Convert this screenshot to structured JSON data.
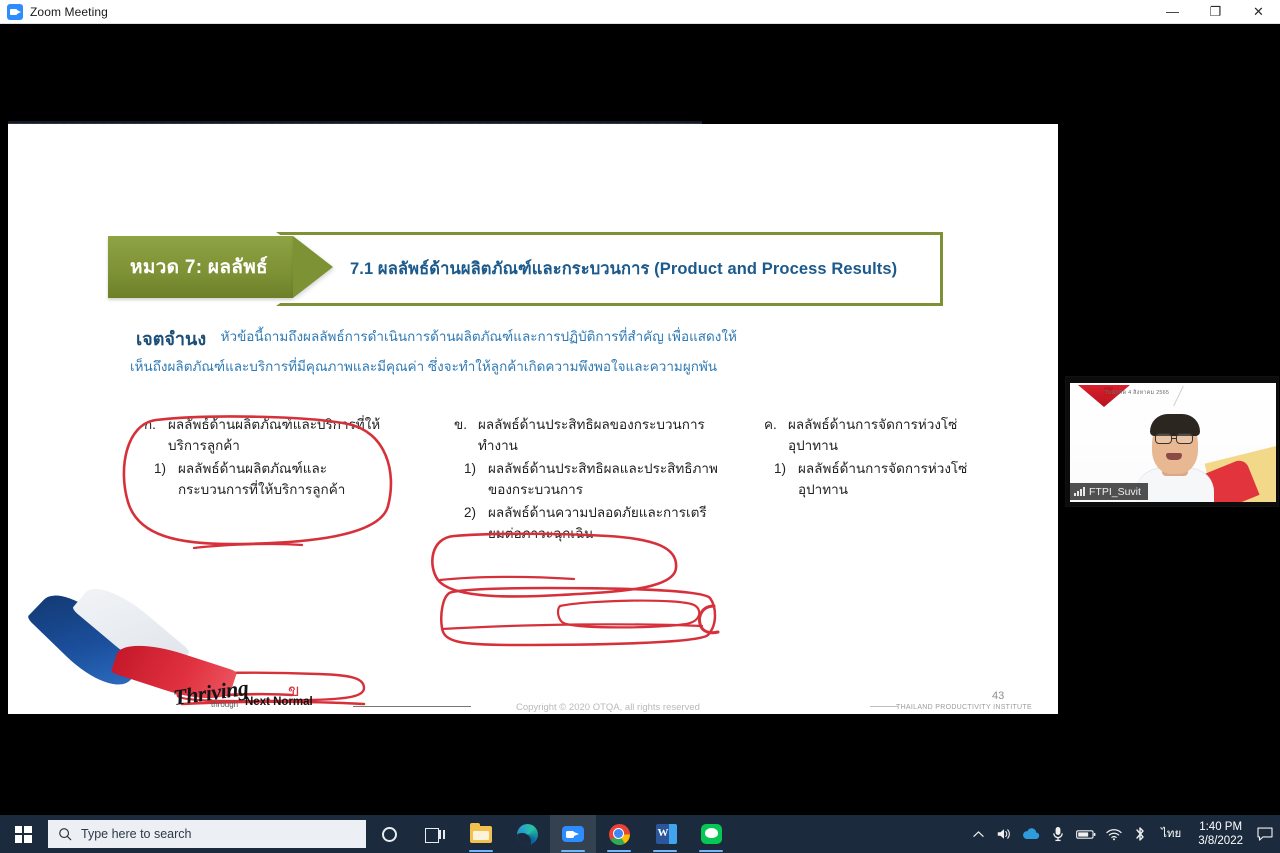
{
  "window": {
    "title": "Zoom Meeting",
    "app_icon": "zoom-video-icon",
    "minimize": "—",
    "maximize": "❐",
    "close": "✕"
  },
  "slide": {
    "banner": {
      "category_label": "หมวด 7: ผลลัพธ์",
      "title": "7.1  ผลลัพธ์ด้านผลิตภัณฑ์และกระบวนการ (Product and Process Results)",
      "green_hex": "#7d9135",
      "title_color_hex": "#1c5a8c"
    },
    "intent": {
      "label": "เจตจำนง",
      "line1": "หัวข้อนี้ถามถึงผลลัพธ์การดำเนินการด้านผลิตภัณฑ์และการปฏิบัติการที่สำคัญ เพื่อแสดงให้",
      "line2": "เห็นถึงผลิตภัณฑ์และบริการที่มีคุณภาพและมีคุณค่า ซึ่งจะทำให้ลูกค้าเกิดความพึงพอใจและความผูกพัน",
      "color_hex": "#2f7ab5"
    },
    "columns": [
      {
        "id": "column-a",
        "items": [
          {
            "marker": "ก.",
            "indent": false,
            "text": "ผลลัพธ์ด้านผลิตภัณฑ์และบริการที่ให้บริการลูกค้า"
          },
          {
            "marker": "1)",
            "indent": true,
            "text": "ผลลัพธ์ด้านผลิตภัณฑ์และกระบวนการที่ให้บริการลูกค้า"
          }
        ]
      },
      {
        "id": "column-b",
        "items": [
          {
            "marker": "ข.",
            "indent": false,
            "text": "ผลลัพธ์ด้านประสิทธิผลของกระบวนการทำงาน"
          },
          {
            "marker": "1)",
            "indent": true,
            "text": "ผลลัพธ์ด้านประสิทธิผลและประสิทธิภาพของกระบวนการ"
          },
          {
            "marker": "2)",
            "indent": true,
            "text": "ผลลัพธ์ด้านความปลอดภัยและการเตรียมต่อภาวะฉุกเฉิน"
          }
        ]
      },
      {
        "id": "column-c",
        "items": [
          {
            "marker": "ค.",
            "indent": false,
            "text": "ผลลัพธ์ด้านการจัดการห่วงโซ่อุปาทาน"
          },
          {
            "marker": "1)",
            "indent": true,
            "text": "ผลลัพธ์ด้านการจัดการห่วงโซ่อุปาทาน"
          }
        ]
      }
    ],
    "annotations": {
      "ink_color_hex": "#d6313a",
      "scribble_letter": "ข",
      "shapes": [
        "ellipse-around-column-a",
        "ellipse-around-column-b-heading",
        "rounded-box-around-column-b-item1",
        "underline-strokes",
        "box-with-letter-and-dashes"
      ]
    },
    "footer": {
      "brand_script": "Thriving",
      "brand_through": "through",
      "brand_next_normal": "Next Normal",
      "copyright": "Copyright © 2020 OTQA, all rights reserved",
      "institute": "THAILAND PRODUCTIVITY INSTITUTE",
      "page_number": "43"
    }
  },
  "video_tile": {
    "participant_name": "FTPI_Suvit",
    "signal_icon": "signal-bars-icon"
  },
  "taskbar": {
    "start_icon": "windows-start-icon",
    "search": {
      "placeholder": "Type here to search",
      "icon": "search-icon"
    },
    "apps": [
      {
        "id": "cortana",
        "icon": "cortana-icon",
        "label": "Cortana",
        "active": false,
        "running": false
      },
      {
        "id": "task-view",
        "icon": "task-view-icon",
        "label": "Task View",
        "active": false,
        "running": false
      },
      {
        "id": "file-explorer",
        "icon": "folder-icon",
        "label": "File Explorer",
        "active": false,
        "running": true
      },
      {
        "id": "edge",
        "icon": "edge-icon",
        "label": "Microsoft Edge",
        "active": false,
        "running": false
      },
      {
        "id": "zoom",
        "icon": "zoom-video-icon",
        "label": "Zoom",
        "active": true,
        "running": true
      },
      {
        "id": "chrome",
        "icon": "chrome-icon",
        "label": "Google Chrome",
        "active": false,
        "running": true
      },
      {
        "id": "word",
        "icon": "word-icon",
        "label": "Microsoft Word",
        "active": false,
        "running": true
      },
      {
        "id": "line",
        "icon": "line-chat-icon",
        "label": "LINE",
        "active": false,
        "running": true
      }
    ],
    "tray": [
      {
        "id": "show-hidden",
        "icon": "chevron-up-icon",
        "glyph": "∧"
      },
      {
        "id": "volume",
        "icon": "speaker-icon",
        "glyph": "🔊"
      },
      {
        "id": "onedrive",
        "icon": "cloud-icon",
        "glyph": "☁"
      },
      {
        "id": "microphone",
        "icon": "microphone-icon",
        "glyph": "🎤"
      },
      {
        "id": "battery",
        "icon": "battery-icon",
        "glyph": "🔋"
      },
      {
        "id": "network",
        "icon": "wifi-icon",
        "glyph": "📶"
      },
      {
        "id": "bluetooth",
        "icon": "bluetooth-icon",
        "glyph": "ᛦ"
      }
    ],
    "language": "ไทย",
    "clock": {
      "time": "1:40 PM",
      "date": "3/8/2022"
    },
    "notification_icon": "notification-center-icon"
  }
}
